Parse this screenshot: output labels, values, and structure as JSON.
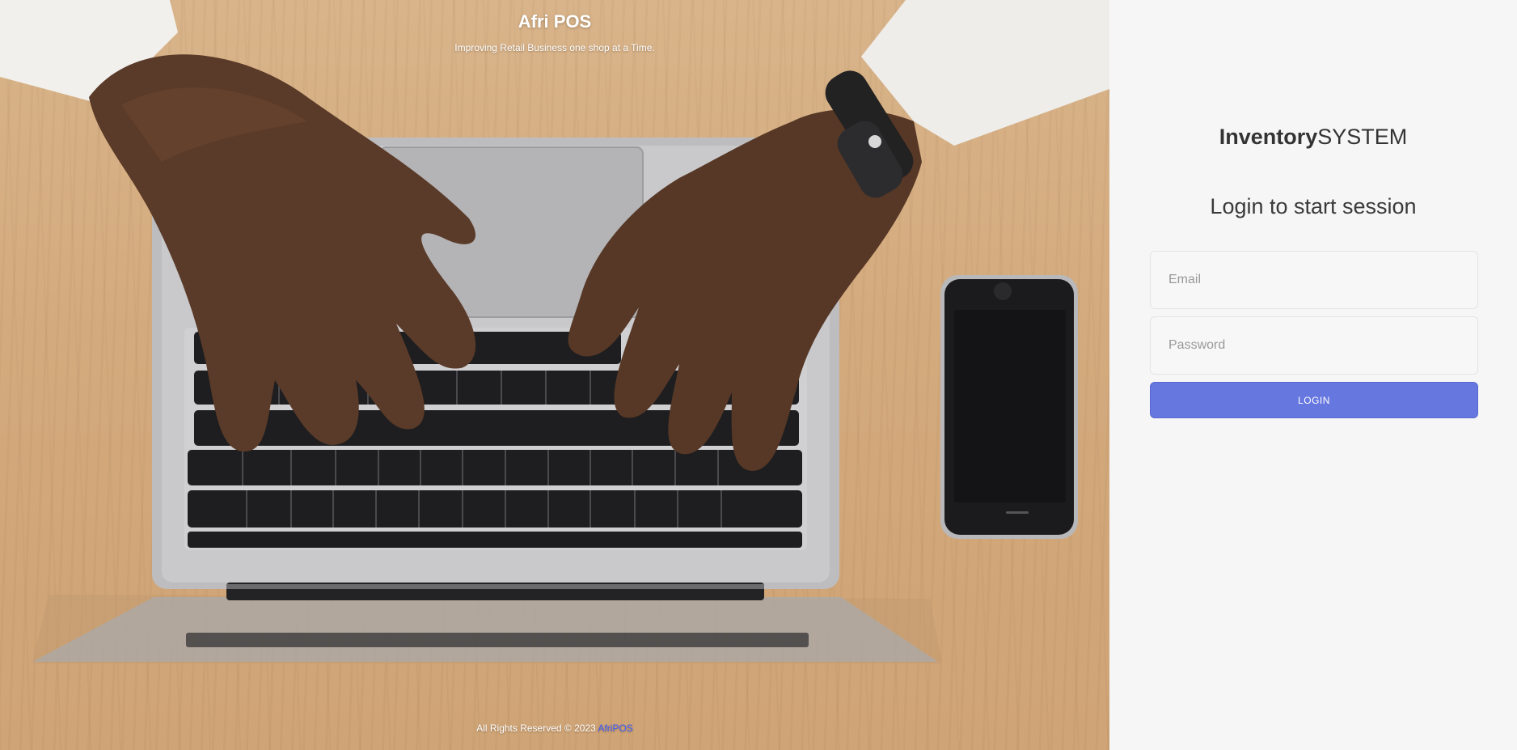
{
  "hero": {
    "title": "Afri POS",
    "tagline": "Improving Retail Business one shop at a Time.",
    "footer_text": "All Rights Reserved © 2023 ",
    "footer_link": "AfriPOS",
    "background_image": "laptop-typing-hands-photo"
  },
  "login": {
    "brand_bold": "Inventory",
    "brand_light": "SYSTEM",
    "subtitle": "Login to start session",
    "email_placeholder": "Email",
    "password_placeholder": "Password",
    "button_label": "LOGIN",
    "accent_color": "#6777e0"
  }
}
